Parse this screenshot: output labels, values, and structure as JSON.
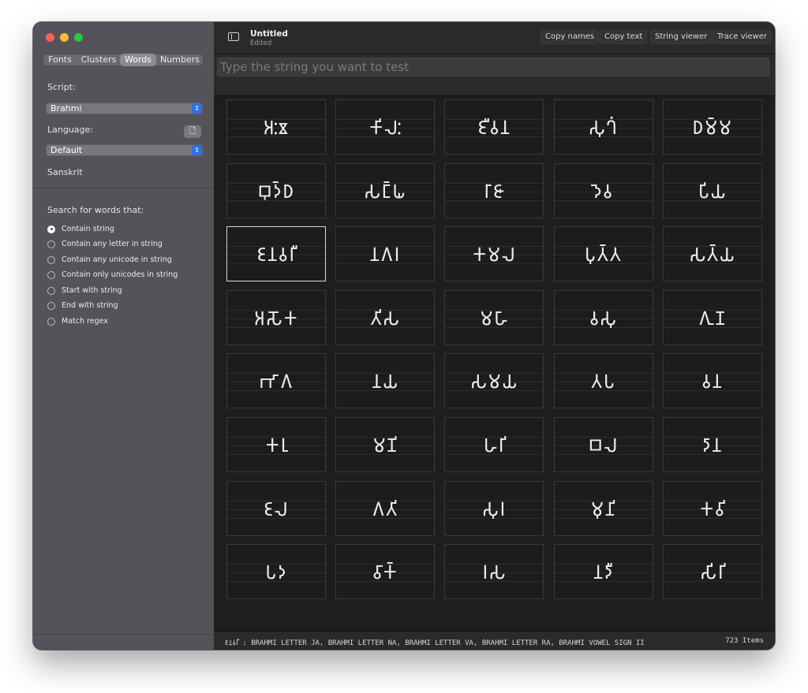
{
  "window": {
    "title": "Untitled",
    "subtitle": "Edited"
  },
  "sidebar": {
    "tabs": [
      "Fonts",
      "Clusters",
      "Words",
      "Numbers"
    ],
    "active_tab": "Words",
    "script_label": "Script:",
    "script_value": "Brahmi",
    "language_label": "Language:",
    "language_value": "Default",
    "language_name": "Sanskrit",
    "search_label": "Search for words that:",
    "search_options": [
      "Contain string",
      "Contain any letter in string",
      "Contain any unicode in string",
      "Contain only unicodes in string",
      "Start with string",
      "End with string",
      "Match regex"
    ],
    "selected_option": 0,
    "icons": {
      "language": "document-add-icon",
      "stepper": "chevron-updown-icon"
    }
  },
  "toolbar": {
    "buttons": [
      "Copy names",
      "Copy text",
      "String viewer",
      "Trace viewer"
    ],
    "sidebar_icon": "sidebar-toggle-icon"
  },
  "input": {
    "placeholder": "Type the string you want to test",
    "value": ""
  },
  "grid": {
    "selected_index": 10,
    "words": [
      "𑀅𑀂𑀃",
      "𑀓𑀺𑀮𑀂",
      "𑀚𑀻𑀯𑀦",
      "𑀲𑀼𑀔𑀁",
      "𑀥𑀫𑁆𑀫",
      "𑀩𑀼𑀤𑁆𑀥",
      "𑀲𑀗𑁆𑀖",
      "𑀭𑀸𑀚𑀸",
      "𑀤𑁂𑀯",
      "𑀧𑀺𑀬",
      "𑀚𑀦𑀯𑀭𑀻",
      "𑀦𑀕𑀭",
      "𑀓𑀫𑀮",
      "𑀧𑀼𑀢𑁆𑀢",
      "𑀲𑀢𑁆𑀬",
      "𑀅𑀲𑁄𑀓",
      "𑀢𑀺𑀲",
      "𑀫𑀳𑀸",
      "𑀯𑀲𑀼",
      "𑀕𑀼𑀡",
      "𑀪𑀸𑀕",
      "𑀦𑀬",
      "𑀲𑀫𑀬",
      "𑀢𑀧",
      "𑀯𑀦",
      "𑀓𑀭𑀼",
      "𑀫𑀡𑀺",
      "𑀳𑀭𑀺",
      "𑀩𑀮",
      "𑀤𑀸𑀦",
      "𑀚𑀮",
      "𑀕𑀢𑀺",
      "𑀲𑀼𑀭",
      "𑀫𑀼𑀦𑀺",
      "𑀓𑀯𑀺",
      "𑀧𑀤",
      "𑀯𑀸𑀓𑁆",
      "𑀭𑀲",
      "𑀦𑀤𑀻",
      "𑀲𑀺𑀭𑀺"
    ]
  },
  "status": {
    "description": "𑀚𑀦𑀯𑀭𑀻 : BRAHMI LETTER JA, BRAHMI LETTER NA, BRAHMI LETTER VA, BRAHMI LETTER RA, BRAHMI VOWEL SIGN II",
    "count": "723 Items"
  },
  "colors": {
    "sidebar_bg": "#55525a",
    "content_bg": "#1e1e1e",
    "accent": "#2f6fe0",
    "traffic_close": "#fe5f57",
    "traffic_min": "#febc2e",
    "traffic_zoom": "#28c840"
  }
}
